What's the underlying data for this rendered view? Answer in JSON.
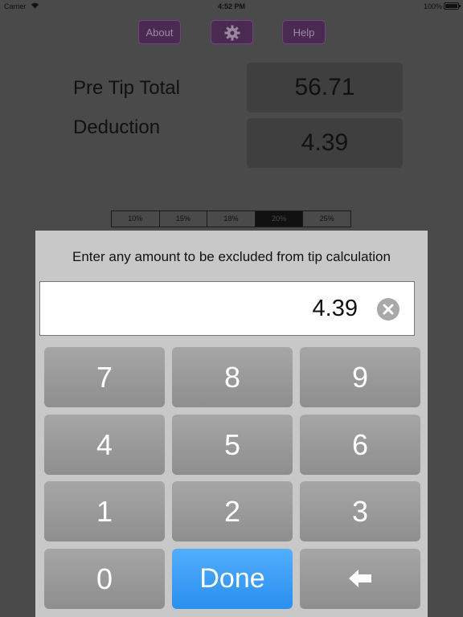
{
  "status_bar": {
    "carrier": "Carrier",
    "time": "4:52 PM",
    "battery": "100%"
  },
  "top_buttons": {
    "about": "About",
    "settings_icon": "gear-icon",
    "help": "Help",
    "accent_color": "#7a3f86"
  },
  "summary": {
    "pre_tip_label": "Pre Tip Total",
    "pre_tip_value": "56.71",
    "deduction_label": "Deduction",
    "deduction_value": "4.39"
  },
  "tip_segments": {
    "options": [
      "10%",
      "15%",
      "18%",
      "20%",
      "25%"
    ],
    "selected": "20%"
  },
  "keypad_popup": {
    "prompt": "Enter any amount to be excluded from tip calculation",
    "input_value": "4.39",
    "clear_icon": "clear-circle-icon",
    "keys": [
      "7",
      "8",
      "9",
      "4",
      "5",
      "6",
      "1",
      "2",
      "3",
      "0"
    ],
    "done_label": "Done",
    "backspace_icon": "backspace-arrow-icon",
    "done_color": "#2a8ff0"
  }
}
